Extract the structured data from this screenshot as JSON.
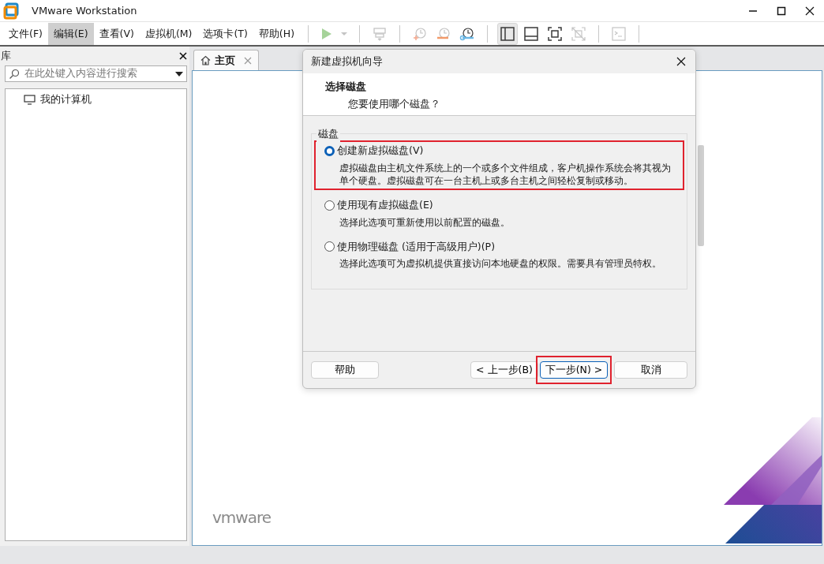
{
  "window": {
    "title": "VMware Workstation"
  },
  "menu": [
    {
      "label": "文件(F)",
      "highlighted": false
    },
    {
      "label": "编辑(E)",
      "highlighted": true
    },
    {
      "label": "查看(V)",
      "highlighted": false
    },
    {
      "label": "虚拟机(M)",
      "highlighted": false
    },
    {
      "label": "选项卡(T)",
      "highlighted": false
    },
    {
      "label": "帮助(H)",
      "highlighted": false
    }
  ],
  "toolbar": [
    {
      "kind": "play",
      "disabled": true,
      "selected": false
    },
    {
      "kind": "separator"
    },
    {
      "kind": "send-keys",
      "disabled": true,
      "selected": false
    },
    {
      "kind": "separator"
    },
    {
      "kind": "snapshot",
      "disabled": true,
      "selected": false
    },
    {
      "kind": "revert",
      "disabled": true,
      "selected": false
    },
    {
      "kind": "manage",
      "disabled": false,
      "selected": false
    },
    {
      "kind": "separator"
    },
    {
      "kind": "library-view",
      "disabled": false,
      "selected": true
    },
    {
      "kind": "thumbnail-view",
      "disabled": false,
      "selected": false
    },
    {
      "kind": "fullscreen",
      "disabled": false,
      "selected": false
    },
    {
      "kind": "unity",
      "disabled": true,
      "selected": false
    },
    {
      "kind": "separator"
    },
    {
      "kind": "console",
      "disabled": true,
      "selected": false
    },
    {
      "kind": "separator"
    }
  ],
  "library": {
    "title": "库",
    "search": {
      "placeholder": "在此处键入内容进行搜索"
    },
    "tree": [
      {
        "label": "我的计算机",
        "selected": false
      }
    ]
  },
  "tabs": [
    {
      "label": "主页",
      "selected": true
    }
  ],
  "home": {
    "logo": "vmware"
  },
  "dialog": {
    "title": "新建虚拟机向导",
    "heading": "选择磁盘",
    "subheading": "您要使用哪个磁盘？",
    "group_label": "磁盘",
    "options": [
      {
        "label": "创建新虚拟磁盘(V)",
        "description": "虚拟磁盘由主机文件系统上的一个或多个文件组成，客户机操作系统会将其视为单个硬盘。虚拟磁盘可在一台主机上或多台主机之间轻松复制或移动。",
        "selected": true,
        "annotated": true
      },
      {
        "label": "使用现有虚拟磁盘(E)",
        "description": "选择此选项可重新使用以前配置的磁盘。",
        "selected": false,
        "annotated": false
      },
      {
        "label": "使用物理磁盘 (适用于高级用户)(P)",
        "description": "选择此选项可为虚拟机提供直接访问本地硬盘的权限。需要具有管理员特权。",
        "selected": false,
        "annotated": false
      }
    ],
    "buttons": [
      {
        "label": "帮助",
        "kind": "help",
        "default": false,
        "annotated": false
      },
      {
        "label": "< 上一步(B)",
        "kind": "nav",
        "default": false,
        "annotated": false
      },
      {
        "label": "下一步(N) >",
        "kind": "nav",
        "default": true,
        "annotated": true
      },
      {
        "label": "取消",
        "kind": "nav",
        "default": false,
        "annotated": false
      }
    ]
  }
}
